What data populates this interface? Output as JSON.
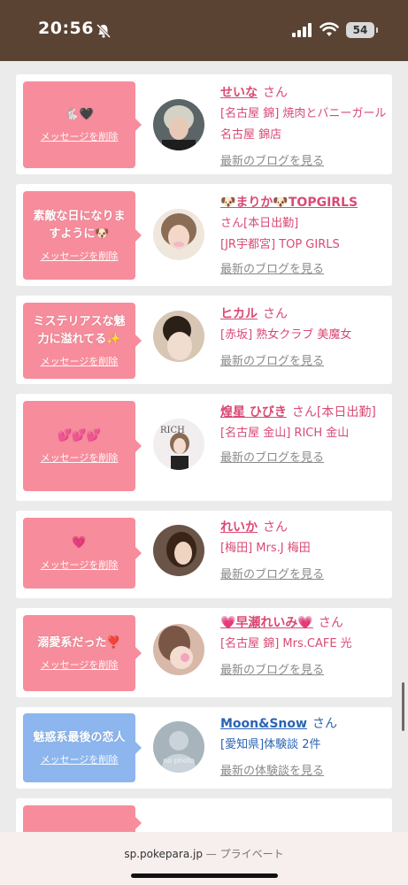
{
  "status": {
    "time": "20:56",
    "battery": "54"
  },
  "cards": [
    {
      "message": "🐇🖤",
      "delete": "メッセージを削除",
      "name": "せいな",
      "san": "さん",
      "line1_extra": "",
      "shop": "[名古屋 錦] 焼肉とバニーガール 名古屋 錦店",
      "link": "最新のブログを見る"
    },
    {
      "message": "素敵な日になりますように🐶",
      "delete": "メッセージを削除",
      "name": "🐶まりか🐶TOPGIRLS",
      "san": "さん[本日出勤]",
      "line1_extra": "",
      "shop": "[JR宇都宮] TOP GIRLS",
      "link": "最新のブログを見る"
    },
    {
      "message": "ミステリアスな魅力に溢れてる✨",
      "delete": "メッセージを削除",
      "name": "ヒカル",
      "san": "さん",
      "line1_extra": "",
      "shop": "[赤坂] 熟女クラブ 美魔女",
      "link": "最新のブログを見る"
    },
    {
      "message": "💕💕💕",
      "delete": "メッセージを削除",
      "name": "煌星 ひびき",
      "san": "さん[本日出勤]",
      "line1_extra": "",
      "shop": "[名古屋 金山] RICH 金山",
      "link": "最新のブログを見る"
    },
    {
      "message": "💗",
      "delete": "メッセージを削除",
      "name": "れいか",
      "san": "さん",
      "line1_extra": "",
      "shop": "[梅田] Mrs.J 梅田",
      "link": "最新のブログを見る"
    },
    {
      "message": "溺愛系だった❣️",
      "delete": "メッセージを削除",
      "name": "💗早瀬れいみ💗",
      "san": "さん",
      "line1_extra": "",
      "shop": "[名古屋 錦] Mrs.CAFE 光",
      "link": "最新のブログを見る"
    },
    {
      "message": "魅惑系最後の恋人",
      "delete": "メッセージを削除",
      "name": "Moon&Snow",
      "san": "さん",
      "line1_extra": "",
      "shop": "[愛知県]体験談 2件",
      "link": "最新の体験談を見る",
      "avatar_text": "no photo"
    }
  ],
  "browser": {
    "url": "sp.pokepara.jp",
    "sep": " — ",
    "mode": "プライベート"
  },
  "colors": {
    "statusbar": "#5a4333",
    "pink": "#f78d9c",
    "blue": "#8db6ef",
    "name_pink": "#d94a74",
    "name_blue": "#2a64b4"
  }
}
